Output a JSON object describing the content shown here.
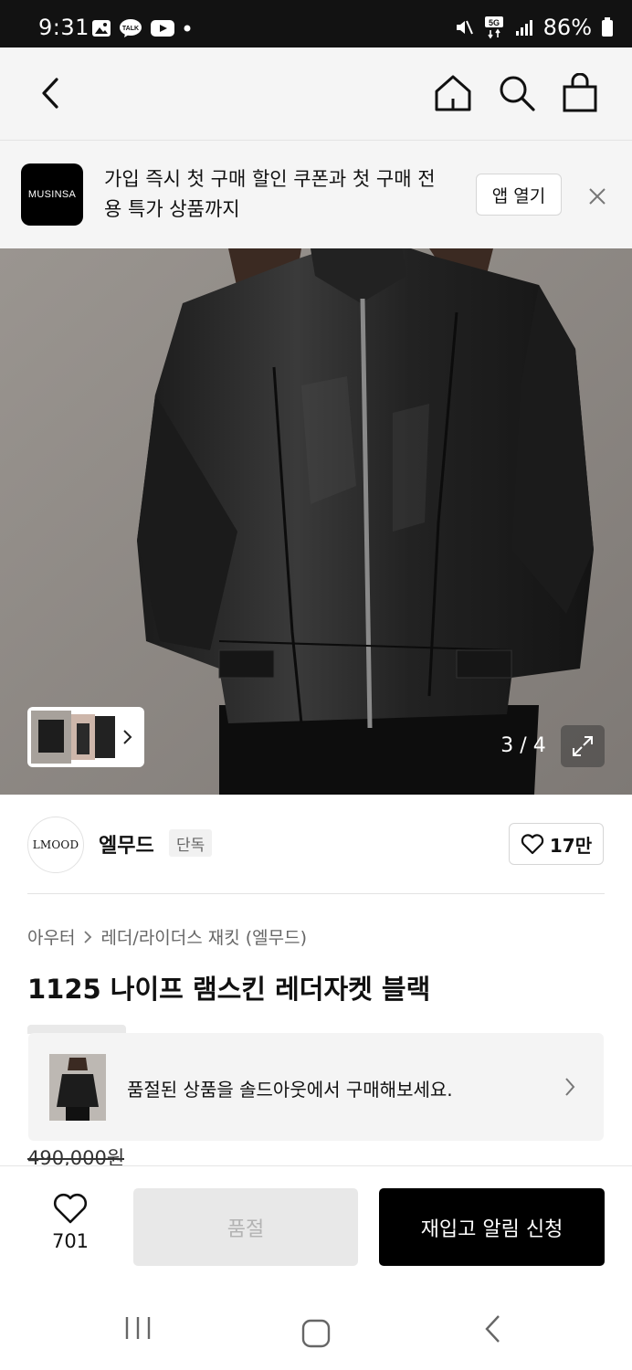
{
  "status_bar": {
    "time": "9:31",
    "notification_icons": [
      "gallery-icon",
      "kakaotalk-icon",
      "youtube-icon",
      "dot-icon"
    ],
    "network": "5G",
    "battery": "86%"
  },
  "header": {
    "icons": [
      "back-icon",
      "home-icon",
      "search-icon",
      "bag-icon"
    ]
  },
  "app_banner": {
    "logo": "MUSINSA",
    "text": "가입 즉시 첫 구매 할인 쿠폰과 첫 구매 전용 특가 상품까지",
    "open_button": "앱 열기"
  },
  "gallery": {
    "counter": "3 / 4"
  },
  "brand": {
    "logo": "LMOOD",
    "name": "엘무드",
    "badge": "단독",
    "likes": "17만"
  },
  "breadcrumb": {
    "category": "아우터",
    "subcategory": "레더/라이더스 재킷 (엘무드)"
  },
  "product": {
    "title": "1125 나이프 램스킨 레더자켓 블랙",
    "soldout_message": "품절된 상품을 솔드아웃에서 구매해보세요.",
    "original_price": "490,000원"
  },
  "bottom_bar": {
    "wish_count": "701",
    "soldout_label": "품절",
    "restock_label": "재입고 알림 신청"
  },
  "colors": {
    "status_bar_bg": "#121212",
    "header_bg": "#f5f5f5",
    "primary_button": "#000000",
    "disabled_button": "#e8e8e8"
  }
}
